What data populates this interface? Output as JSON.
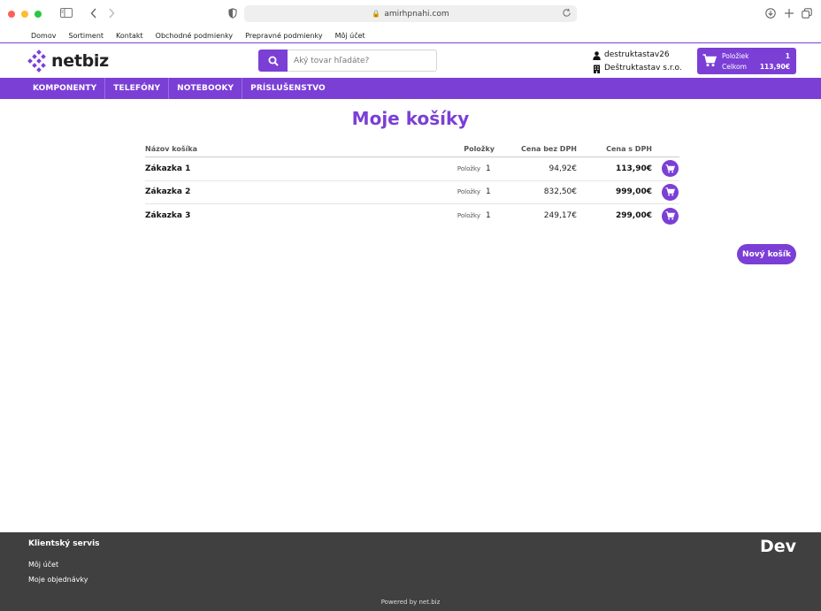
{
  "browser": {
    "url": "amirhpnahi.com"
  },
  "top_links": [
    "Domov",
    "Sortiment",
    "Kontakt",
    "Obchodné podmienky",
    "Prepravné podmienky",
    "Môj účet"
  ],
  "logo": {
    "text": "netbiz"
  },
  "search": {
    "placeholder": "Aký tovar hľadáte?"
  },
  "user": {
    "username": "destruktastav26",
    "company": "Deštruktastav s.r.o."
  },
  "cart_summary": {
    "items_label": "Položiek",
    "items_value": "1",
    "total_label": "Celkom",
    "total_value": "113,90€"
  },
  "nav": [
    "KOMPONENTY",
    "TELEFÓNY",
    "NOTEBOOKY",
    "PRÍSLUŠENSTVO"
  ],
  "page": {
    "title": "Moje košíky"
  },
  "table": {
    "headers": {
      "name": "Názov košíka",
      "items": "Položky",
      "net": "Cena bez DPH",
      "gross": "Cena s DPH"
    },
    "rows": [
      {
        "name": "Zákazka 1",
        "items_label": "Položky",
        "qty": "1",
        "net": "94,92€",
        "gross": "113,90€"
      },
      {
        "name": "Zákazka 2",
        "items_label": "Položky",
        "qty": "1",
        "net": "832,50€",
        "gross": "999,00€"
      },
      {
        "name": "Zákazka 3",
        "items_label": "Položky",
        "qty": "1",
        "net": "249,17€",
        "gross": "299,00€"
      }
    ]
  },
  "new_cart_label": "Nový košík",
  "footer": {
    "title": "Klientský servis",
    "links": [
      "Môj účet",
      "Moje objednávky"
    ],
    "badge": "Dev",
    "powered": "Powered by net.biz"
  },
  "colors": {
    "accent": "#7b3fd6",
    "footer_bg": "#404040"
  }
}
